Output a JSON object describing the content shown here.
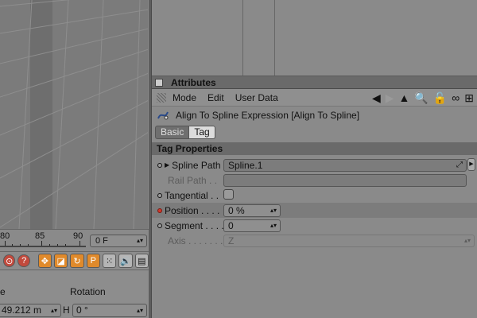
{
  "timeline": {
    "ticks": [
      "80",
      "85",
      "90"
    ],
    "frame_value": "0 F"
  },
  "coords": {
    "col1_header": "e",
    "col2_header": "Rotation",
    "position_value": "49.212 m",
    "h_label": "H",
    "rotation_value": "0 °"
  },
  "attributes": {
    "panel_title": "Attributes",
    "menu": [
      "Mode",
      "Edit",
      "User Data"
    ],
    "object_title": "Align To Spline Expression [Align To Spline]",
    "tabs": [
      "Basic",
      "Tag"
    ],
    "section_title": "Tag Properties",
    "properties": {
      "spline_path": {
        "label": "Spline Path",
        "value": "Spline.1"
      },
      "rail_path": {
        "label": "Rail Path . ."
      },
      "tangential": {
        "label": "Tangential . ."
      },
      "position": {
        "label": "Position . . . .",
        "value": "0 %"
      },
      "segment": {
        "label": "Segment . . . .",
        "value": "0"
      },
      "axis": {
        "label": "Axis . . . . . . . .",
        "value": "Z"
      }
    }
  },
  "colors": {
    "panel_bg": "#8a8a8a",
    "header_bg": "#6a6a6a",
    "keyframe_red": "#d0382b"
  }
}
